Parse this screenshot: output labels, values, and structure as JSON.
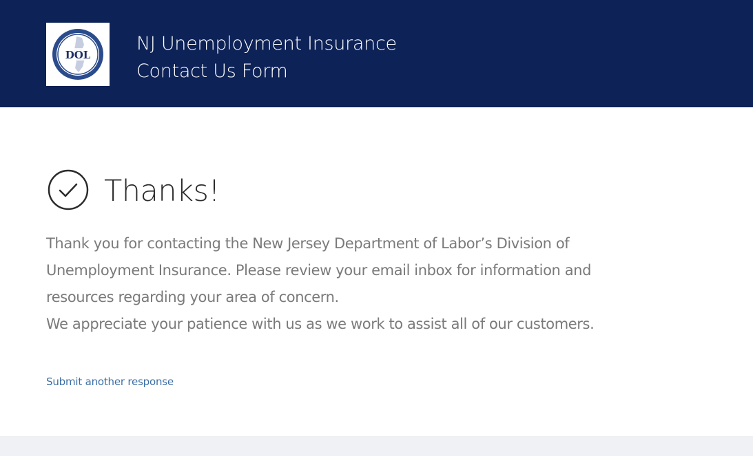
{
  "header": {
    "logo_text": "DOL",
    "title_line1": "NJ Unemployment Insurance",
    "title_line2": "Contact Us Form"
  },
  "confirmation": {
    "icon": "check-circle-icon",
    "title": "Thanks!",
    "message_lines": [
      "Thank you for contacting the New Jersey Department of Labor’s Division of",
      "Unemployment Insurance. Please review your email inbox for information and",
      "resources regarding your area of concern.",
      "We appreciate your patience with us as we work to assist all of our customers."
    ],
    "submit_another_label": "Submit another response"
  },
  "colors": {
    "header_bg": "#0d2257",
    "link": "#3d6fa6",
    "body_text": "#7a7a7a"
  }
}
